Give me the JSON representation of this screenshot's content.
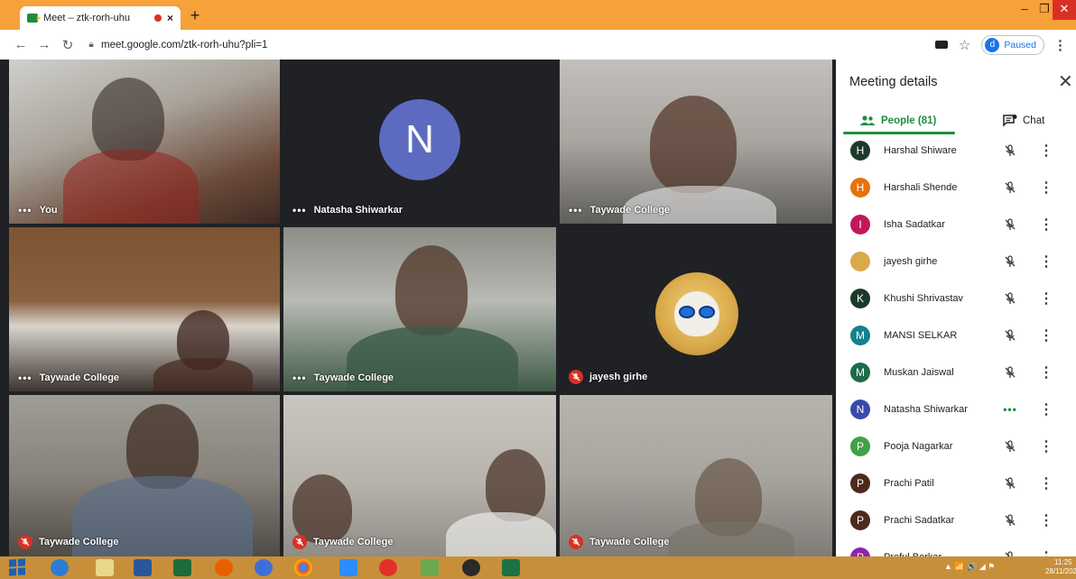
{
  "browser": {
    "tab_title": "Meet – ztk-rorh-uhu",
    "tab_close": "×",
    "new_tab": "+",
    "url": "meet.google.com/ztk-rorh-uhu?pli=1",
    "profile_initial": "d",
    "profile_status": "Paused",
    "win_min": "–",
    "win_max": "❐",
    "win_close": "✕"
  },
  "tiles": [
    {
      "label": "You",
      "muted": false
    },
    {
      "label": "Natasha Shiwarkar",
      "muted": false,
      "avatar_letter": "N"
    },
    {
      "label": "Taywade College",
      "muted": false
    },
    {
      "label": "Taywade College",
      "muted": false
    },
    {
      "label": "Taywade College",
      "muted": false
    },
    {
      "label": "jayesh girhe",
      "muted": true
    },
    {
      "label": "Taywade College",
      "muted": true
    },
    {
      "label": "Taywade College",
      "muted": true
    },
    {
      "label": "Taywade College",
      "muted": true
    }
  ],
  "panel": {
    "title": "Meeting details",
    "people_tab": "People (81)",
    "chat_tab": "Chat",
    "people": [
      {
        "initial": "H",
        "name": "Harshal Shiware",
        "color": "#1b3a2a",
        "status": "muted"
      },
      {
        "initial": "H",
        "name": "Harshali Shende",
        "color": "#e8710a",
        "status": "muted"
      },
      {
        "initial": "I",
        "name": "Isha Sadatkar",
        "color": "#c2185b",
        "status": "muted"
      },
      {
        "initial": "",
        "name": "jayesh girhe",
        "color": "#d9a94a",
        "status": "muted"
      },
      {
        "initial": "K",
        "name": "Khushi Shrivastav",
        "color": "#1b3a2a",
        "status": "muted"
      },
      {
        "initial": "M",
        "name": "MANSI SELKAR",
        "color": "#12828c",
        "status": "muted"
      },
      {
        "initial": "M",
        "name": "Muskan Jaiswal",
        "color": "#1e6b4a",
        "status": "muted"
      },
      {
        "initial": "N",
        "name": "Natasha Shiwarkar",
        "color": "#3949ab",
        "status": "active"
      },
      {
        "initial": "P",
        "name": "Pooja Nagarkar",
        "color": "#43a047",
        "status": "muted"
      },
      {
        "initial": "P",
        "name": "Prachi Patil",
        "color": "#4e2a1e",
        "status": "muted"
      },
      {
        "initial": "P",
        "name": "Prachi Sadatkar",
        "color": "#4e2a1e",
        "status": "muted"
      },
      {
        "initial": "P",
        "name": "Praful Borkar",
        "color": "#8e24aa",
        "status": "muted"
      }
    ]
  },
  "taskbar": {
    "time": "11:25",
    "date": "28/11/2020"
  }
}
